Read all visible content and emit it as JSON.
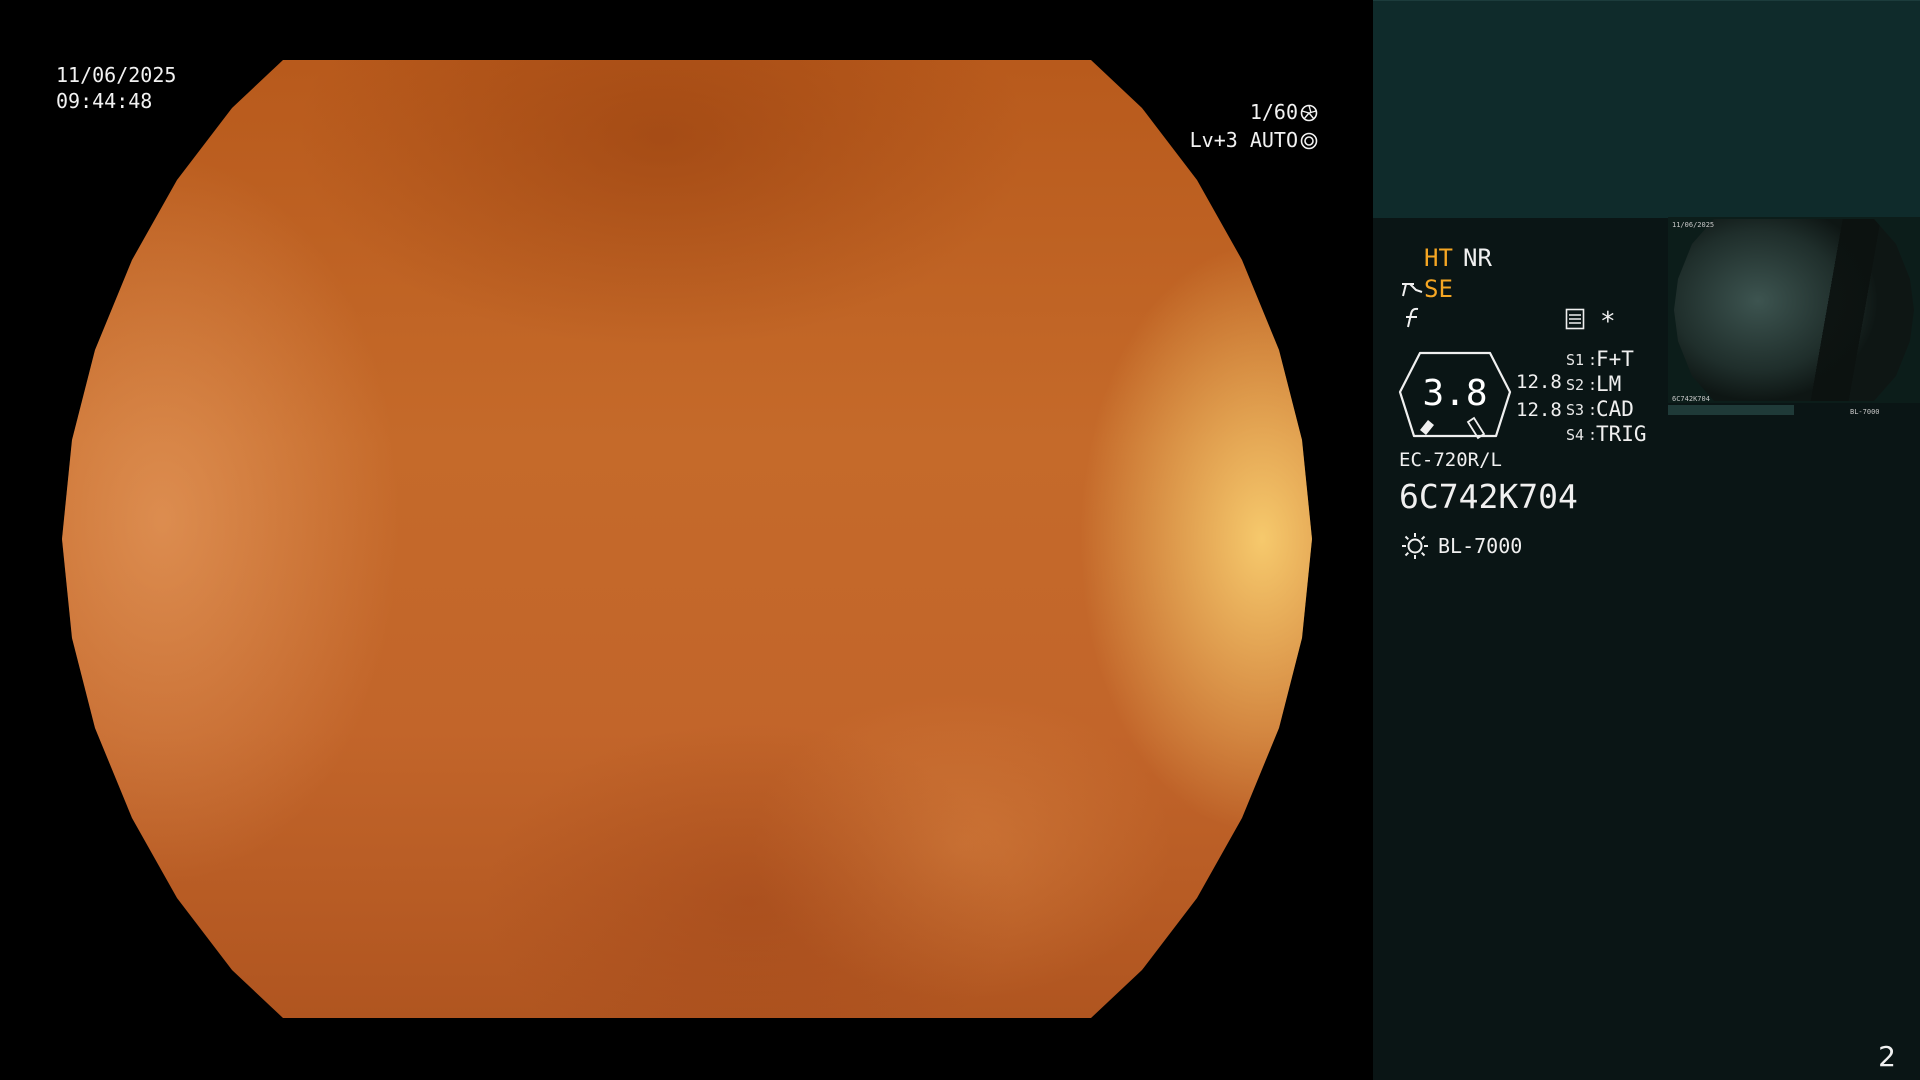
{
  "osd": {
    "date": "11/06/2025",
    "time": "09:44:48",
    "shutter": "1/60",
    "level": "Lv+3",
    "iris_mode": "AUTO",
    "shutter_icon": "aperture-icon",
    "iris_icon": "iris-ring-icon"
  },
  "panel": {
    "ht_label": "HT",
    "nr_label": "NR",
    "se_label": "SE",
    "se_icon": "angle-bracket-icon",
    "f_icon": "function-f-icon",
    "settings_icon": "menu-box-icon",
    "asterisk": "*",
    "zoom_value": "3.8",
    "zoom_sub_top": "12.8",
    "zoom_sub_bottom": "12.8",
    "switches": [
      {
        "key": "S1",
        "value": "F+T"
      },
      {
        "key": "S2",
        "value": "LM"
      },
      {
        "key": "S3",
        "value": "CAD"
      },
      {
        "key": "S4",
        "value": "TRIG"
      }
    ],
    "scope_model": "EC-720R/L",
    "scope_serial": "6C742K704",
    "light_source": "BL-7000",
    "light_icon": "sun-lamp-icon",
    "accent_color": "#f5a623",
    "panel_color": "#0a1515",
    "panel_top_color": "#0f2b2b"
  },
  "thumbnail": {
    "text_date": "11/06/2025",
    "text_serial": "6C742K704",
    "text_light": "BL-7000"
  },
  "page_number": "2"
}
